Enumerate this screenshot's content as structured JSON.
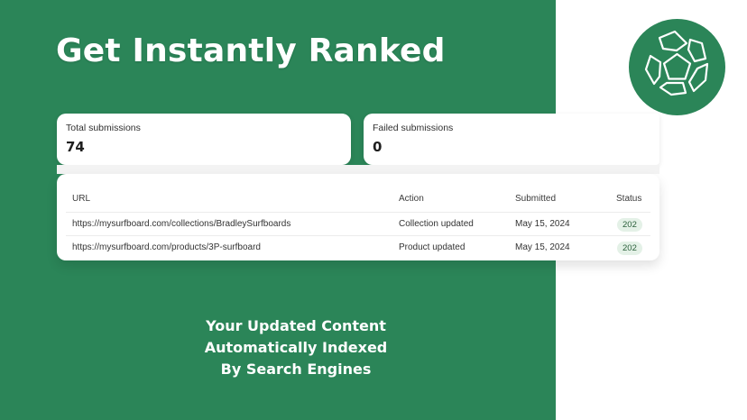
{
  "headline": "Get Instantly Ranked",
  "logo": {
    "icon": "pentagon-logo-icon"
  },
  "stats": {
    "total_label": "Total submissions",
    "total_value": "74",
    "failed_label": "Failed submissions",
    "failed_value": "0"
  },
  "table": {
    "headers": {
      "url": "URL",
      "action": "Action",
      "submitted": "Submitted",
      "status": "Status"
    },
    "rows": [
      {
        "url": "https://mysurfboard.com/collections/BradleySurfboards",
        "action": "Collection updated",
        "submitted": "May 15, 2024",
        "status": "202"
      },
      {
        "url": "https://mysurfboard.com/products/3P-surfboard",
        "action": "Product updated",
        "submitted": "May 15, 2024",
        "status": "202"
      }
    ]
  },
  "tagline": {
    "line1": "Your Updated Content",
    "line2": "Automatically Indexed",
    "line3": "By Search Engines"
  },
  "colors": {
    "brand_green": "#2b8558",
    "badge_bg": "#e4f1e7",
    "badge_text": "#2a5f3a"
  }
}
